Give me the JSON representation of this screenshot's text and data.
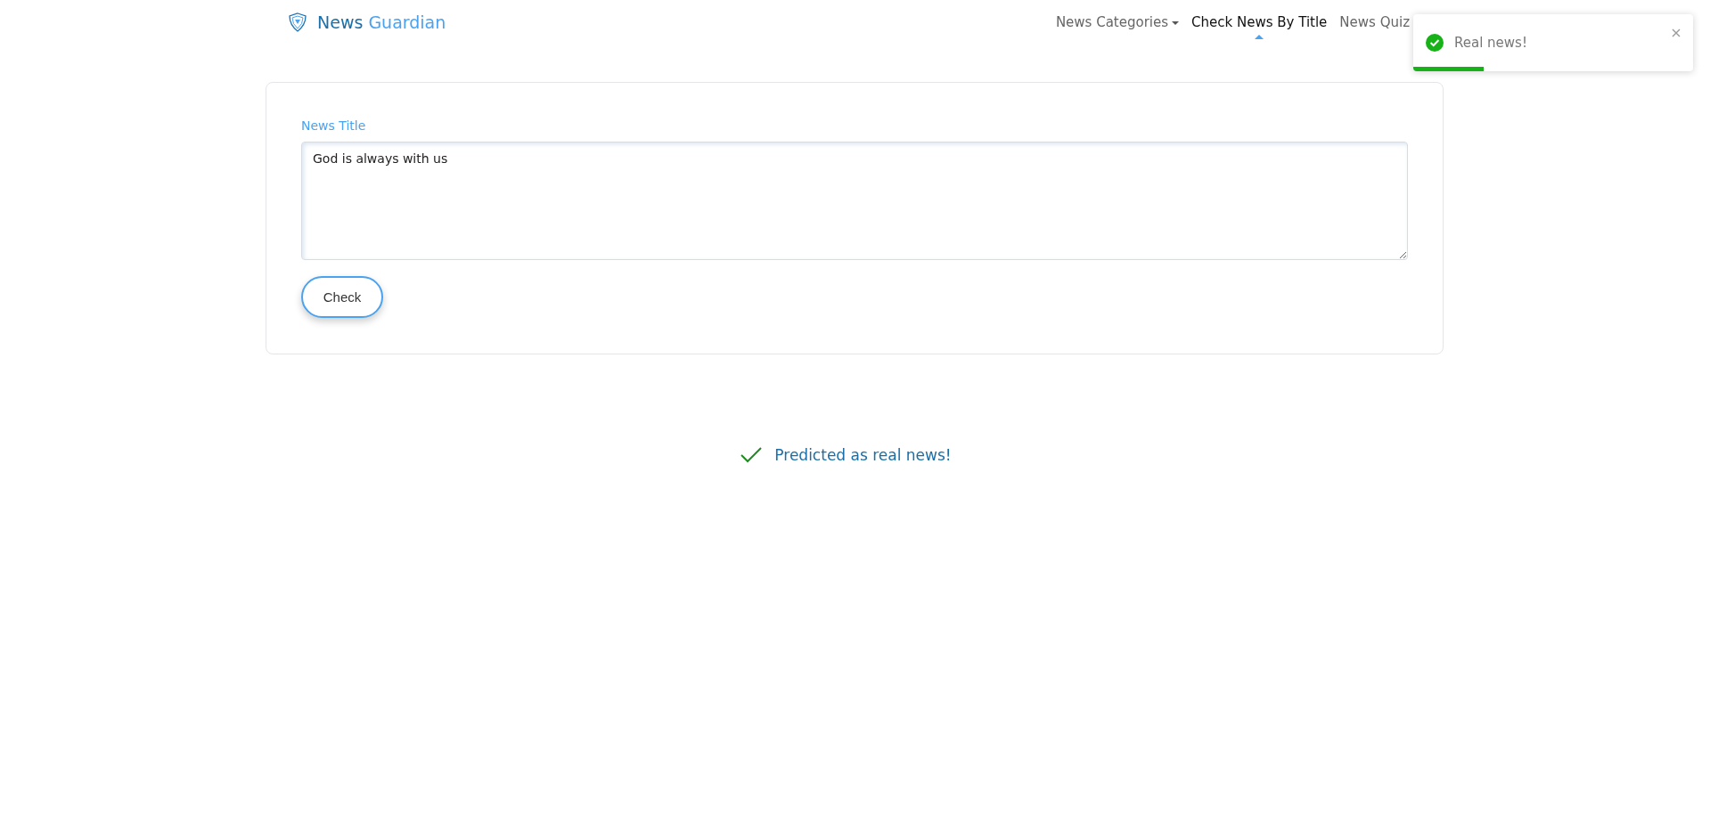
{
  "brand": {
    "first": "News",
    "second": "Guardian"
  },
  "nav": [
    {
      "label": "News Categories",
      "kind": "dropdown",
      "selected": false
    },
    {
      "label": "Check News By Title",
      "kind": "link",
      "selected": true
    },
    {
      "label": "News Quiz",
      "kind": "link",
      "selected": false
    }
  ],
  "form": {
    "label": "News Title",
    "value": "God is always with us",
    "button": "Check"
  },
  "result": {
    "text": "Predicted as real news!",
    "real": true
  },
  "toast": {
    "message": "Real news!",
    "level": 0.25
  }
}
